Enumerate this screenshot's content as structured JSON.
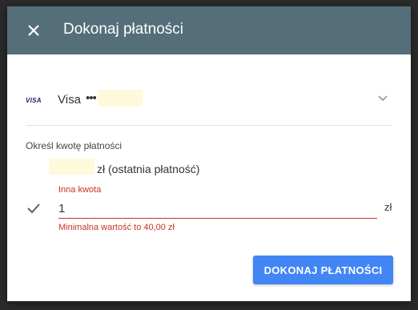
{
  "dialog": {
    "title": "Dokonaj płatności",
    "close_icon": "close-icon"
  },
  "payment_method": {
    "card_logo": "VISA",
    "card_name": "Visa",
    "card_mask": "•••",
    "dropdown_icon": "chevron-down-icon"
  },
  "amount_section": {
    "label": "Określ kwotę płatności",
    "last_payment_label": "zł (ostatnia płatność)",
    "selected_icon": "check-icon",
    "custom_amount_label": "Inna kwota",
    "custom_amount_value": "1",
    "currency": "zł",
    "error": "Minimalna wartość to 40,00 zł"
  },
  "actions": {
    "pay_label": "DOKONAJ PŁATNOŚCI"
  },
  "colors": {
    "header": "#546e7a",
    "accent": "#4285f4",
    "error": "#c5341f"
  }
}
